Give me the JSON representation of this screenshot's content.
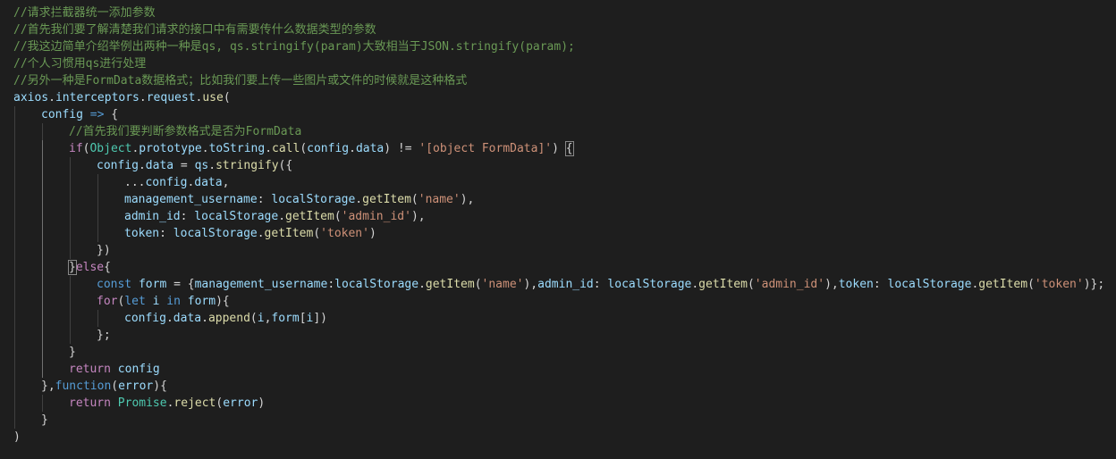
{
  "editor": {
    "lines": [
      {
        "indent": 0,
        "tokens": [
          {
            "t": "c",
            "v": "//请求拦截器统一添加参数"
          }
        ]
      },
      {
        "indent": 0,
        "tokens": [
          {
            "t": "c",
            "v": "//首先我们要了解清楚我们请求的接口中有需要传什么数据类型的参数"
          }
        ]
      },
      {
        "indent": 0,
        "tokens": [
          {
            "t": "c",
            "v": "//我这边简单介绍举例出两种一种是qs, qs.stringify(param)大致相当于JSON.stringify(param);"
          }
        ]
      },
      {
        "indent": 0,
        "tokens": [
          {
            "t": "c",
            "v": "//个人习惯用qs进行处理"
          }
        ]
      },
      {
        "indent": 0,
        "tokens": [
          {
            "t": "c",
            "v": "//另外一种是FormData数据格式；比如我们要上传一些图片或文件的时候就是这种格式"
          }
        ]
      },
      {
        "indent": 0,
        "tokens": [
          {
            "t": "v",
            "v": "axios"
          },
          {
            "t": "p",
            "v": "."
          },
          {
            "t": "v",
            "v": "interceptors"
          },
          {
            "t": "p",
            "v": "."
          },
          {
            "t": "v",
            "v": "request"
          },
          {
            "t": "p",
            "v": "."
          },
          {
            "t": "f",
            "v": "use"
          },
          {
            "t": "p",
            "v": "("
          }
        ]
      },
      {
        "indent": 1,
        "tokens": [
          {
            "t": "v",
            "v": "config"
          },
          {
            "t": "p",
            "v": " "
          },
          {
            "t": "st",
            "v": "=>"
          },
          {
            "t": "p",
            "v": " {"
          }
        ]
      },
      {
        "indent": 2,
        "tokens": [
          {
            "t": "c",
            "v": "//首先我们要判断参数格式是否为FormData"
          }
        ]
      },
      {
        "indent": 2,
        "tokens": [
          {
            "t": "k",
            "v": "if"
          },
          {
            "t": "p",
            "v": "("
          },
          {
            "t": "t",
            "v": "Object"
          },
          {
            "t": "p",
            "v": "."
          },
          {
            "t": "v",
            "v": "prototype"
          },
          {
            "t": "p",
            "v": "."
          },
          {
            "t": "v",
            "v": "toString"
          },
          {
            "t": "p",
            "v": "."
          },
          {
            "t": "f",
            "v": "call"
          },
          {
            "t": "p",
            "v": "("
          },
          {
            "t": "v",
            "v": "config"
          },
          {
            "t": "p",
            "v": "."
          },
          {
            "t": "v",
            "v": "data"
          },
          {
            "t": "p",
            "v": ") != "
          },
          {
            "t": "s",
            "v": "'[object FormData]'"
          },
          {
            "t": "p",
            "v": ") "
          },
          {
            "t": "p",
            "v": "{",
            "m": true
          }
        ]
      },
      {
        "indent": 3,
        "tokens": [
          {
            "t": "v",
            "v": "config"
          },
          {
            "t": "p",
            "v": "."
          },
          {
            "t": "v",
            "v": "data"
          },
          {
            "t": "p",
            "v": " = "
          },
          {
            "t": "v",
            "v": "qs"
          },
          {
            "t": "p",
            "v": "."
          },
          {
            "t": "f",
            "v": "stringify"
          },
          {
            "t": "p",
            "v": "({"
          }
        ]
      },
      {
        "indent": 4,
        "tokens": [
          {
            "t": "p",
            "v": "..."
          },
          {
            "t": "v",
            "v": "config"
          },
          {
            "t": "p",
            "v": "."
          },
          {
            "t": "v",
            "v": "data"
          },
          {
            "t": "p",
            "v": ","
          }
        ]
      },
      {
        "indent": 4,
        "tokens": [
          {
            "t": "v",
            "v": "management_username"
          },
          {
            "t": "p",
            "v": ": "
          },
          {
            "t": "v",
            "v": "localStorage"
          },
          {
            "t": "p",
            "v": "."
          },
          {
            "t": "f",
            "v": "getItem"
          },
          {
            "t": "p",
            "v": "("
          },
          {
            "t": "s",
            "v": "'name'"
          },
          {
            "t": "p",
            "v": "),"
          }
        ]
      },
      {
        "indent": 4,
        "tokens": [
          {
            "t": "v",
            "v": "admin_id"
          },
          {
            "t": "p",
            "v": ": "
          },
          {
            "t": "v",
            "v": "localStorage"
          },
          {
            "t": "p",
            "v": "."
          },
          {
            "t": "f",
            "v": "getItem"
          },
          {
            "t": "p",
            "v": "("
          },
          {
            "t": "s",
            "v": "'admin_id'"
          },
          {
            "t": "p",
            "v": "),"
          }
        ]
      },
      {
        "indent": 4,
        "tokens": [
          {
            "t": "v",
            "v": "token"
          },
          {
            "t": "p",
            "v": ": "
          },
          {
            "t": "v",
            "v": "localStorage"
          },
          {
            "t": "p",
            "v": "."
          },
          {
            "t": "f",
            "v": "getItem"
          },
          {
            "t": "p",
            "v": "("
          },
          {
            "t": "s",
            "v": "'token'"
          },
          {
            "t": "p",
            "v": ")"
          }
        ]
      },
      {
        "indent": 3,
        "tokens": [
          {
            "t": "p",
            "v": "})"
          }
        ]
      },
      {
        "indent": 2,
        "tokens": [
          {
            "t": "p",
            "v": "}",
            "m": true
          },
          {
            "t": "k",
            "v": "else"
          },
          {
            "t": "p",
            "v": "{"
          }
        ]
      },
      {
        "indent": 3,
        "tokens": [
          {
            "t": "st",
            "v": "const"
          },
          {
            "t": "p",
            "v": " "
          },
          {
            "t": "v",
            "v": "form"
          },
          {
            "t": "p",
            "v": " = {"
          },
          {
            "t": "v",
            "v": "management_username"
          },
          {
            "t": "p",
            "v": ":"
          },
          {
            "t": "v",
            "v": "localStorage"
          },
          {
            "t": "p",
            "v": "."
          },
          {
            "t": "f",
            "v": "getItem"
          },
          {
            "t": "p",
            "v": "("
          },
          {
            "t": "s",
            "v": "'name'"
          },
          {
            "t": "p",
            "v": "),"
          },
          {
            "t": "v",
            "v": "admin_id"
          },
          {
            "t": "p",
            "v": ": "
          },
          {
            "t": "v",
            "v": "localStorage"
          },
          {
            "t": "p",
            "v": "."
          },
          {
            "t": "f",
            "v": "getItem"
          },
          {
            "t": "p",
            "v": "("
          },
          {
            "t": "s",
            "v": "'admin_id'"
          },
          {
            "t": "p",
            "v": "),"
          },
          {
            "t": "v",
            "v": "token"
          },
          {
            "t": "p",
            "v": ": "
          },
          {
            "t": "v",
            "v": "localStorage"
          },
          {
            "t": "p",
            "v": "."
          },
          {
            "t": "f",
            "v": "getItem"
          },
          {
            "t": "p",
            "v": "("
          },
          {
            "t": "s",
            "v": "'token'"
          },
          {
            "t": "p",
            "v": ")};"
          }
        ]
      },
      {
        "indent": 3,
        "tokens": [
          {
            "t": "k",
            "v": "for"
          },
          {
            "t": "p",
            "v": "("
          },
          {
            "t": "st",
            "v": "let"
          },
          {
            "t": "p",
            "v": " "
          },
          {
            "t": "v",
            "v": "i"
          },
          {
            "t": "p",
            "v": " "
          },
          {
            "t": "st",
            "v": "in"
          },
          {
            "t": "p",
            "v": " "
          },
          {
            "t": "v",
            "v": "form"
          },
          {
            "t": "p",
            "v": "){"
          }
        ]
      },
      {
        "indent": 4,
        "tokens": [
          {
            "t": "v",
            "v": "config"
          },
          {
            "t": "p",
            "v": "."
          },
          {
            "t": "v",
            "v": "data"
          },
          {
            "t": "p",
            "v": "."
          },
          {
            "t": "f",
            "v": "append"
          },
          {
            "t": "p",
            "v": "("
          },
          {
            "t": "v",
            "v": "i"
          },
          {
            "t": "p",
            "v": ","
          },
          {
            "t": "v",
            "v": "form"
          },
          {
            "t": "p",
            "v": "["
          },
          {
            "t": "v",
            "v": "i"
          },
          {
            "t": "p",
            "v": "])"
          }
        ]
      },
      {
        "indent": 3,
        "tokens": [
          {
            "t": "p",
            "v": "};"
          }
        ]
      },
      {
        "indent": 2,
        "tokens": [
          {
            "t": "p",
            "v": "}"
          }
        ]
      },
      {
        "indent": 2,
        "tokens": [
          {
            "t": "k",
            "v": "return"
          },
          {
            "t": "p",
            "v": " "
          },
          {
            "t": "v",
            "v": "config"
          }
        ]
      },
      {
        "indent": 1,
        "tokens": [
          {
            "t": "p",
            "v": "},"
          },
          {
            "t": "st",
            "v": "function"
          },
          {
            "t": "p",
            "v": "("
          },
          {
            "t": "v",
            "v": "error"
          },
          {
            "t": "p",
            "v": "){"
          }
        ]
      },
      {
        "indent": 2,
        "tokens": [
          {
            "t": "k",
            "v": "return"
          },
          {
            "t": "p",
            "v": " "
          },
          {
            "t": "t",
            "v": "Promise"
          },
          {
            "t": "p",
            "v": "."
          },
          {
            "t": "f",
            "v": "reject"
          },
          {
            "t": "p",
            "v": "("
          },
          {
            "t": "v",
            "v": "error"
          },
          {
            "t": "p",
            "v": ")"
          }
        ]
      },
      {
        "indent": 1,
        "tokens": [
          {
            "t": "p",
            "v": "}"
          }
        ]
      },
      {
        "indent": 0,
        "tokens": [
          {
            "t": "p",
            "v": ")"
          }
        ]
      }
    ]
  }
}
